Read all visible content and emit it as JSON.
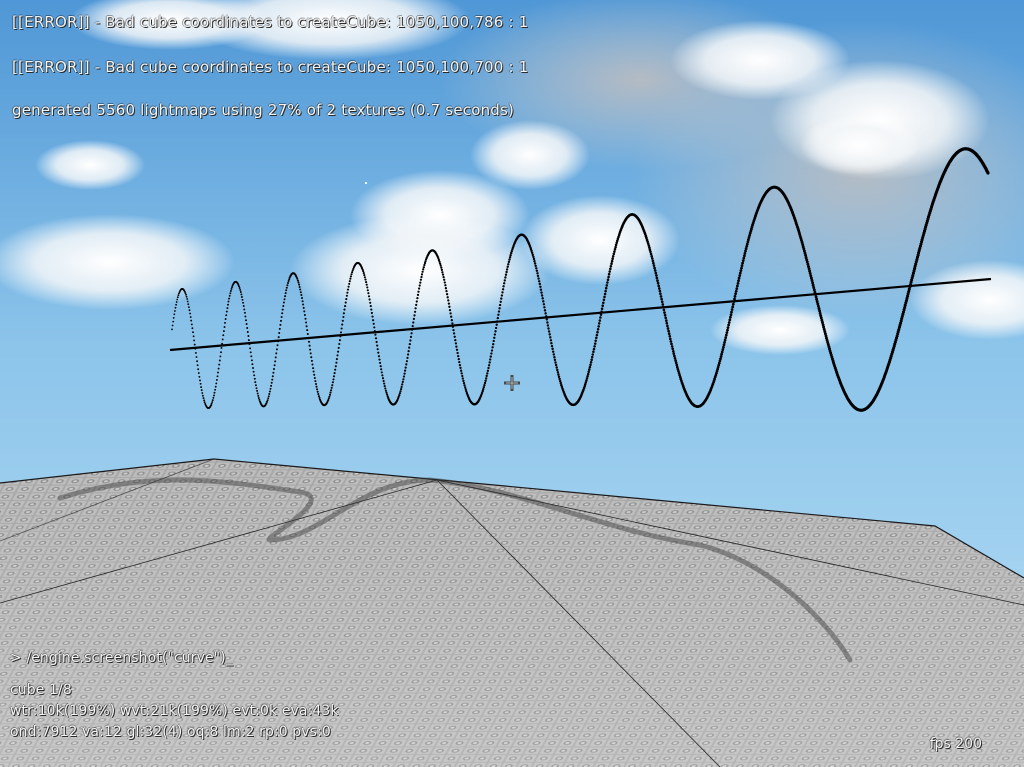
{
  "console": {
    "lines": [
      "[[ERROR]] - Bad cube coordinates to createCube: 1050,100,786 : 1",
      "[[ERROR]] - Bad cube coordinates to createCube: 1050,100,700 : 1",
      "generated 5560 lightmaps using 27% of 2 textures (0.7 seconds)"
    ]
  },
  "command": {
    "text": "> /engine.screenshot(\"curve\")_"
  },
  "stats": {
    "lines": [
      "cube 1/8",
      "wtr:10k(199%) wvt:21k(199%) evt:0k eva:43k",
      "ond:7912 va:12 gl:32(4) oq:8 lm:2 rp:0 pvs:0"
    ]
  },
  "fps": {
    "text": "fps 200"
  },
  "scene": {
    "crosshair_icon": "crosshair-plus-icon",
    "sky_color": "#8fc6ea",
    "floor_color": "#a9a9a9",
    "curve_color": "#000000"
  }
}
